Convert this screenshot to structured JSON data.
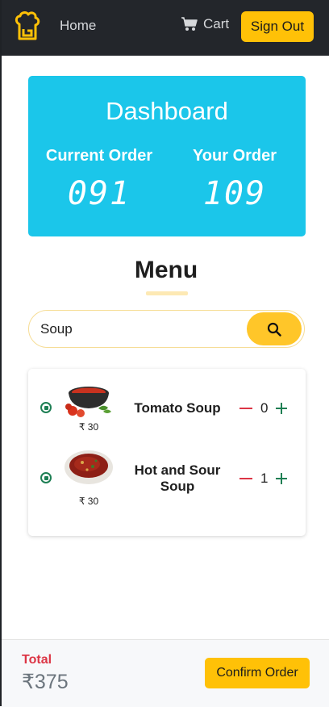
{
  "navbar": {
    "home_label": "Home",
    "cart_label": "Cart",
    "signout_label": "Sign Out"
  },
  "dashboard": {
    "title": "Dashboard",
    "current_order_label": "Current Order",
    "current_order_value": "091",
    "your_order_label": "Your Order",
    "your_order_value": "109"
  },
  "menu": {
    "title": "Menu",
    "search": {
      "value": "Soup"
    },
    "items": [
      {
        "name": "Tomato Soup",
        "price": "₹ 30",
        "quantity": "0",
        "selected": true
      },
      {
        "name": "Hot and Sour Soup",
        "price": "₹ 30",
        "quantity": "1",
        "selected": true
      }
    ]
  },
  "footer": {
    "total_label": "Total",
    "total_value": "₹375",
    "confirm_label": "Confirm Order"
  },
  "colors": {
    "navbar_bg": "#23262b",
    "accent_yellow": "#ffc107",
    "dashboard_bg": "#1bc6ea",
    "total_red": "#dc3545",
    "qty_plus_green": "#1e7f54"
  },
  "icons": [
    "chef-hat-logo-icon",
    "cart-icon",
    "search-icon",
    "minus-icon",
    "plus-icon",
    "radio-selected-icon"
  ]
}
